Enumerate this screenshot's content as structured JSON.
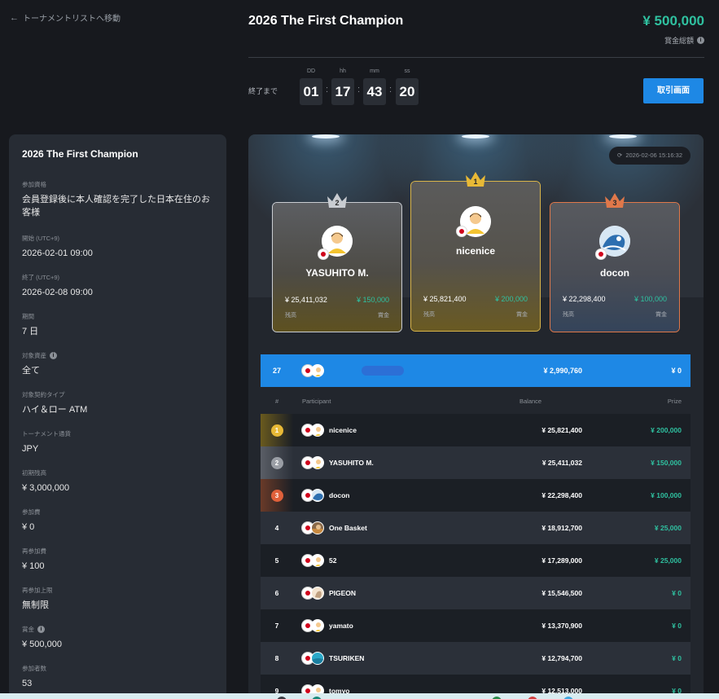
{
  "nav": {
    "back_label": "トーナメントリストへ移動"
  },
  "header": {
    "title": "2026 The First Champion",
    "prize_total": "¥ 500,000",
    "prize_label": "賞金総額",
    "countdown_label": "終了まで",
    "countdown": [
      {
        "unit": "DD",
        "value": "01"
      },
      {
        "unit": "hh",
        "value": "17"
      },
      {
        "unit": "mm",
        "value": "43"
      },
      {
        "unit": "ss",
        "value": "20"
      }
    ],
    "trade_button": "取引画面"
  },
  "sidebar": {
    "title": "2026 The First Champion",
    "fields": [
      {
        "label": "参加資格",
        "value": "会員登録後に本人確認を完了した日本在住のお客様"
      },
      {
        "label": "開始 (UTC+9)",
        "value": "2026-02-01 09:00"
      },
      {
        "label": "終了 (UTC+9)",
        "value": "2026-02-08 09:00"
      },
      {
        "label": "期間",
        "value": "7 日"
      },
      {
        "label": "対象資産",
        "value": "全て"
      },
      {
        "label": "対象契約タイプ",
        "value": "ハイ＆ロー ATM"
      },
      {
        "label": "トーナメント通貨",
        "value": "JPY"
      },
      {
        "label": "初期残高",
        "value": "¥ 3,000,000"
      },
      {
        "label": "参加費",
        "value": "¥ 0"
      },
      {
        "label": "再参加費",
        "value": "¥ 100"
      },
      {
        "label": "再参加上限",
        "value": "無制限"
      },
      {
        "label": "賞金",
        "value": "¥ 500,000"
      },
      {
        "label": "参加者数",
        "value": "53"
      }
    ]
  },
  "leaderboard": {
    "timestamp": "2026-02-06 15:16:32",
    "balance_label": "残高",
    "prize_label": "賞金",
    "podium": [
      {
        "rank": "2",
        "name": "YASUHITO M.",
        "balance": "¥ 25,411,032",
        "prize": "¥ 150,000"
      },
      {
        "rank": "1",
        "name": "nicenice",
        "balance": "¥ 25,821,400",
        "prize": "¥ 200,000"
      },
      {
        "rank": "3",
        "name": "docon",
        "balance": "¥ 22,298,400",
        "prize": "¥ 100,000"
      }
    ],
    "my_row": {
      "rank": "27",
      "balance": "¥ 2,990,760",
      "prize": "¥ 0"
    },
    "columns": {
      "rank": "#",
      "participant": "Participant",
      "balance": "Balance",
      "prize": "Prize"
    },
    "rows": [
      {
        "rank": "1",
        "name": "nicenice",
        "balance": "¥ 25,821,400",
        "prize": "¥ 200,000"
      },
      {
        "rank": "2",
        "name": "YASUHITO M.",
        "balance": "¥ 25,411,032",
        "prize": "¥ 150,000"
      },
      {
        "rank": "3",
        "name": "docon",
        "balance": "¥ 22,298,400",
        "prize": "¥ 100,000"
      },
      {
        "rank": "4",
        "name": "One Basket",
        "balance": "¥ 18,912,700",
        "prize": "¥ 25,000"
      },
      {
        "rank": "5",
        "name": "52",
        "balance": "¥ 17,289,000",
        "prize": "¥ 25,000"
      },
      {
        "rank": "6",
        "name": "PIGEON",
        "balance": "¥ 15,546,500",
        "prize": "¥ 0"
      },
      {
        "rank": "7",
        "name": "yamato",
        "balance": "¥ 13,370,900",
        "prize": "¥ 0"
      },
      {
        "rank": "8",
        "name": "TSURIKEN",
        "balance": "¥ 12,794,700",
        "prize": "¥ 0"
      },
      {
        "rank": "9",
        "name": "tomyo",
        "balance": "¥ 12,513,000",
        "prize": "¥ 0"
      }
    ]
  },
  "colors": {
    "accent": "#1e88e5",
    "prize_green": "#2fc1a0",
    "gold": "#d9b44a",
    "silver": "#c9ccd1",
    "bronze": "#e0784a"
  }
}
